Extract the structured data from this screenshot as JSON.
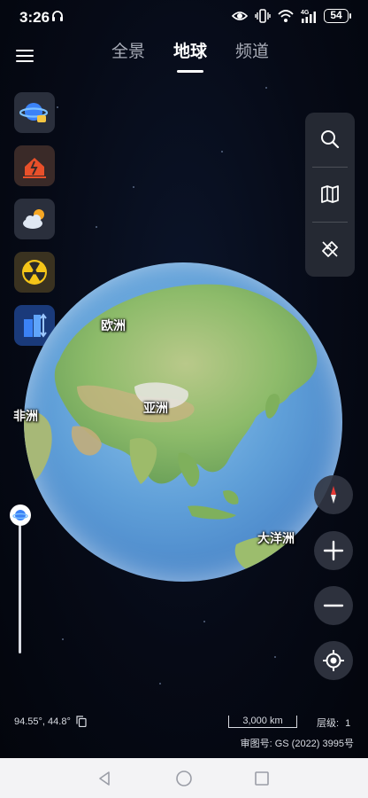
{
  "status_bar": {
    "time": "3:26",
    "network": "4G",
    "battery": "54"
  },
  "tabs": [
    {
      "label": "全景",
      "active": false
    },
    {
      "label": "地球",
      "active": true
    },
    {
      "label": "频道",
      "active": false
    }
  ],
  "layers": [
    {
      "icon": "planet-layer-icon"
    },
    {
      "icon": "earthquake-layer-icon"
    },
    {
      "icon": "weather-layer-icon"
    },
    {
      "icon": "radiation-layer-icon"
    },
    {
      "icon": "buildings-layer-icon"
    }
  ],
  "tools": [
    {
      "icon": "search-icon"
    },
    {
      "icon": "map-icon"
    },
    {
      "icon": "ruler-icon"
    }
  ],
  "globe": {
    "labels": {
      "europe": "欧洲",
      "asia": "亚洲",
      "africa": "非洲",
      "oceania": "大洋洲"
    }
  },
  "zoom_slider": {
    "level_fraction": 0.0
  },
  "info": {
    "coordinates": "94.55°, 44.8°",
    "scale": "3,000 km",
    "level_label": "层级:",
    "level_value": "1",
    "approval": "审图号: GS (2022) 3995号"
  },
  "colors": {
    "accent": "#1a73e8",
    "background": "#04070f",
    "ocean": "#5f9fd8",
    "land": "#8dbb6a"
  }
}
